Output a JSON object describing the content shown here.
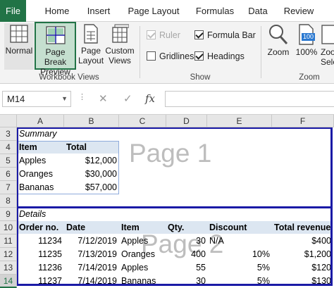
{
  "ribbon": {
    "tabs": [
      "File",
      "Home",
      "Insert",
      "Page Layout",
      "Formulas",
      "Data",
      "Review"
    ],
    "workbook_views": {
      "normal": "Normal",
      "page_break_preview": [
        "Page Break",
        "Preview"
      ],
      "page_layout": [
        "Page",
        "Layout"
      ],
      "custom_views": [
        "Custom",
        "Views"
      ],
      "group_label": "Workbook Views"
    },
    "show": {
      "ruler": "Ruler",
      "formula_bar": "Formula Bar",
      "gridlines": "Gridlines",
      "headings": "Headings",
      "group_label": "Show"
    },
    "zoom": {
      "zoom": "Zoom",
      "hundred": "100%",
      "hundred_badge": "100",
      "zoom_to_selection": [
        "Zoo",
        "Sele"
      ],
      "group_label": "Zoom"
    }
  },
  "formula_bar": {
    "name_box": "M14",
    "cancel_symbol": "✕",
    "enter_symbol": "✓",
    "fx_symbol": "fx",
    "value": ""
  },
  "columns": [
    "A",
    "B",
    "C",
    "D",
    "E",
    "F"
  ],
  "rows": [
    "3",
    "4",
    "5",
    "6",
    "7",
    "8",
    "9",
    "10",
    "11",
    "12",
    "13",
    "14"
  ],
  "sheet": {
    "summary_title": "Summary",
    "summary_headers": [
      "Item",
      "Total"
    ],
    "summary_rows": [
      [
        "Apples",
        "$12,000"
      ],
      [
        "Oranges",
        "$30,000"
      ],
      [
        "Bananas",
        "$57,000"
      ]
    ],
    "details_title": "Details",
    "details_headers": [
      "Order no.",
      "Date",
      "Item",
      "Qty.",
      "Discount",
      "Total revenue"
    ],
    "details_rows": [
      [
        "11234",
        "7/12/2019",
        "Apples",
        "30",
        "N/A",
        "$400"
      ],
      [
        "11235",
        "7/13/2019",
        "Oranges",
        "400",
        "10%",
        "$1,200"
      ],
      [
        "11236",
        "7/14/2019",
        "Apples",
        "55",
        "5%",
        "$120"
      ],
      [
        "11237",
        "7/14/2019",
        "Bananas",
        "30",
        "5%",
        "$130"
      ]
    ],
    "page1_label": "Page 1",
    "page2_label": "Page 2"
  },
  "colors": {
    "excel_green": "#217346",
    "page_break_blue": "#1a1aa6",
    "table_header": "#dce6f1"
  }
}
